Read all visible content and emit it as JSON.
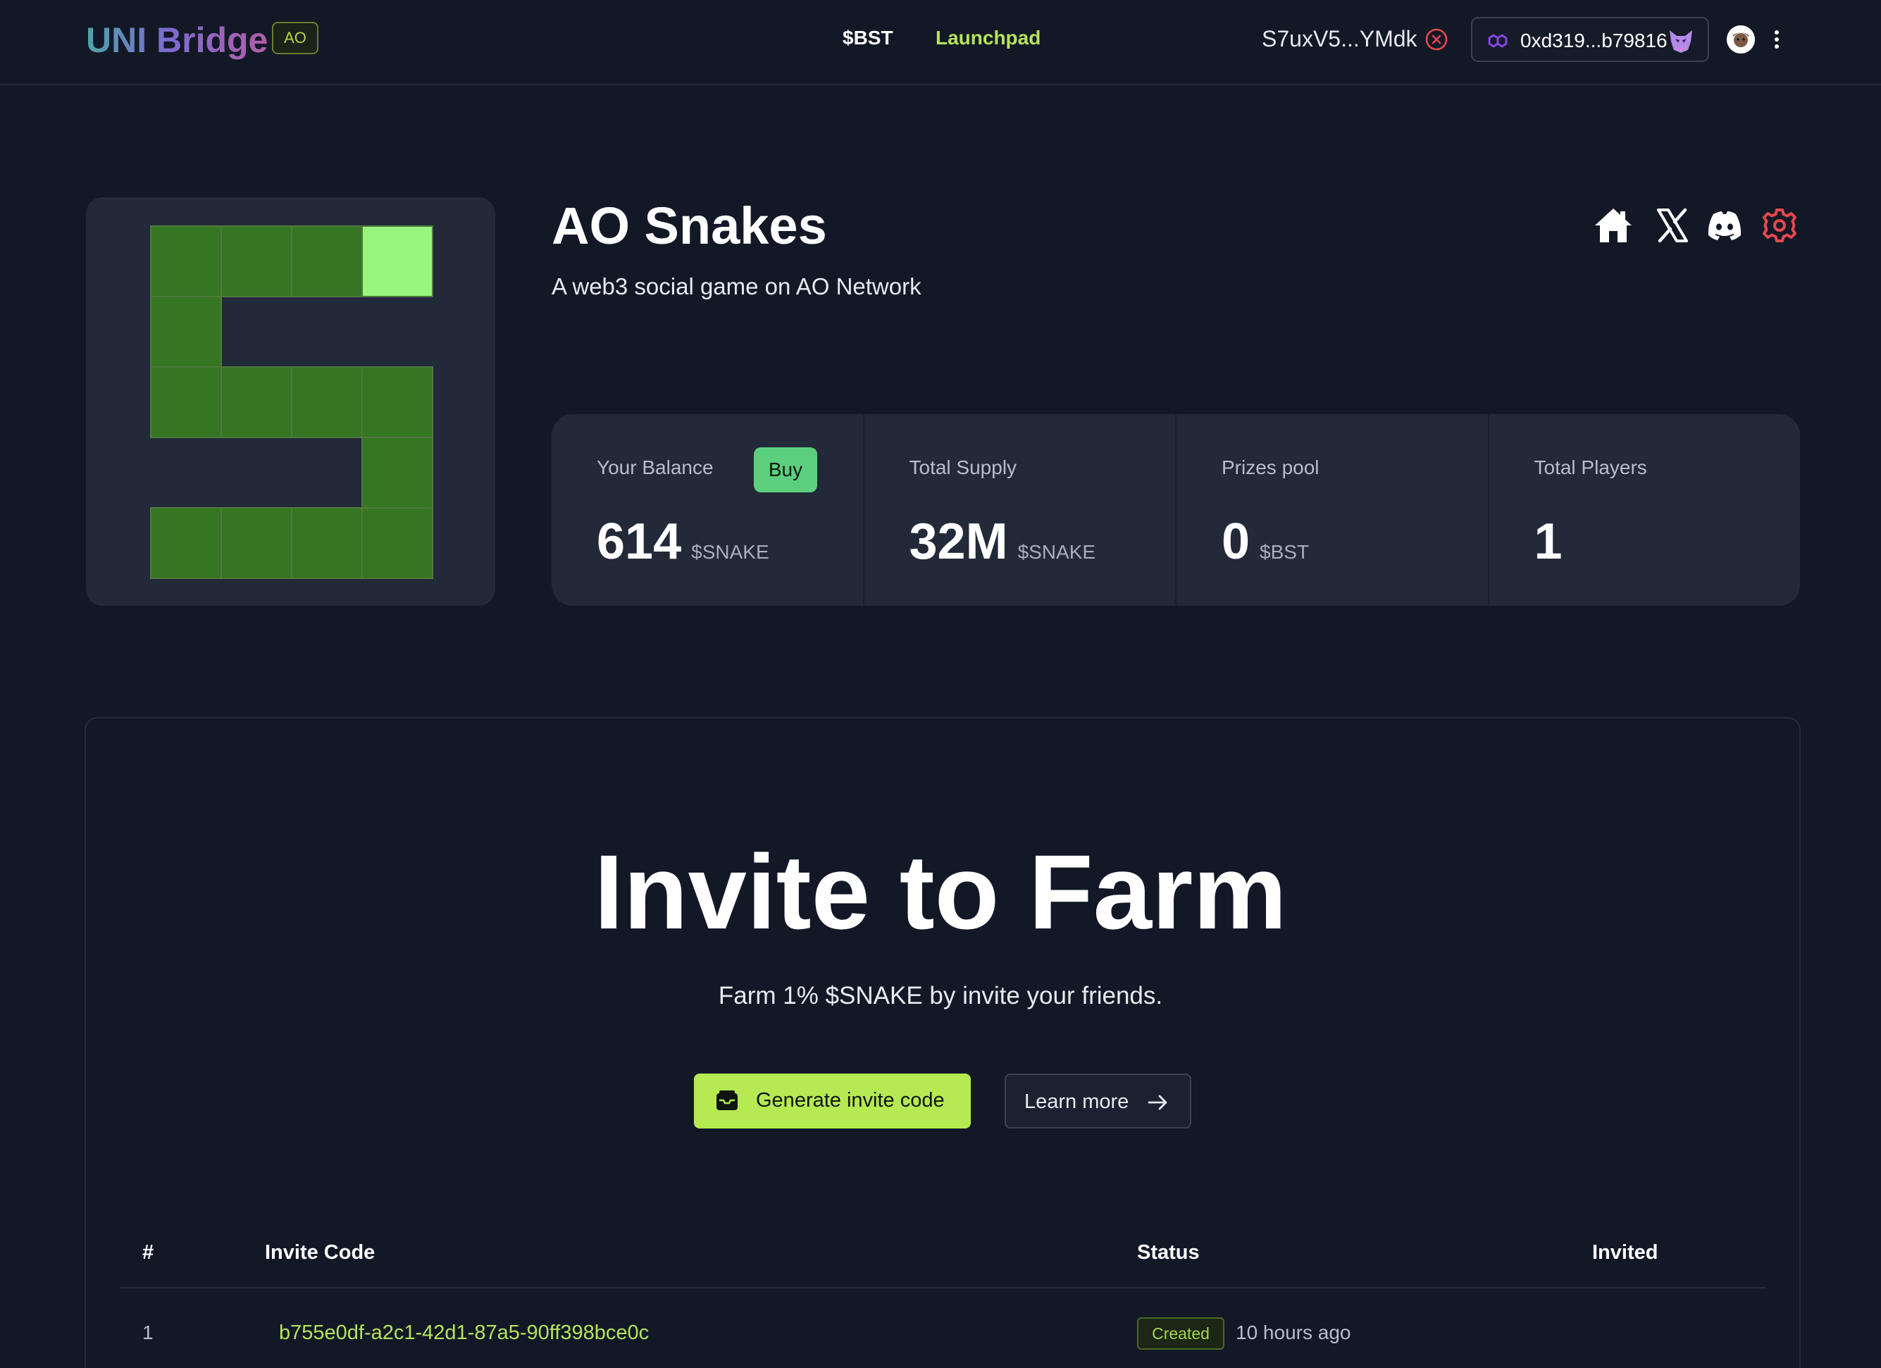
{
  "header": {
    "logo": "UNI Bridge",
    "network_badge": "AO",
    "nav": [
      {
        "label": "$BST"
      },
      {
        "label": "Launchpad"
      }
    ],
    "ar_wallet": "S7uxV5...YMdk",
    "evm_wallet": "0xd319...b79816"
  },
  "game": {
    "title": "AO Snakes",
    "description": "A web3 social game on AO Network"
  },
  "stats": [
    {
      "label": "Your Balance",
      "value": "614",
      "unit": "$SNAKE",
      "action": "Buy"
    },
    {
      "label": "Total Supply",
      "value": "32M",
      "unit": "$SNAKE"
    },
    {
      "label": "Prizes pool",
      "value": "0",
      "unit": "$BST"
    },
    {
      "label": "Total Players",
      "value": "1",
      "unit": ""
    }
  ],
  "invite": {
    "title": "Invite to Farm",
    "subtitle": "Farm 1% $SNAKE by invite your friends.",
    "generate_label": "Generate invite code",
    "learn_label": "Learn more"
  },
  "table": {
    "columns": [
      "#",
      "Invite Code",
      "Status",
      "Invited"
    ],
    "rows": [
      {
        "num": "1",
        "code": "b755e0df-a2c1-42d1-87a5-90ff398bce0c",
        "status": "Created",
        "time": "10 hours ago",
        "invited": ""
      }
    ]
  },
  "colors": {
    "background": "#121826",
    "card": "#222938",
    "accent_green": "#b5ea52",
    "buy_green": "#5ccf7e",
    "snake_body": "#367522",
    "snake_head": "#98f57e",
    "danger": "#e5484d"
  }
}
